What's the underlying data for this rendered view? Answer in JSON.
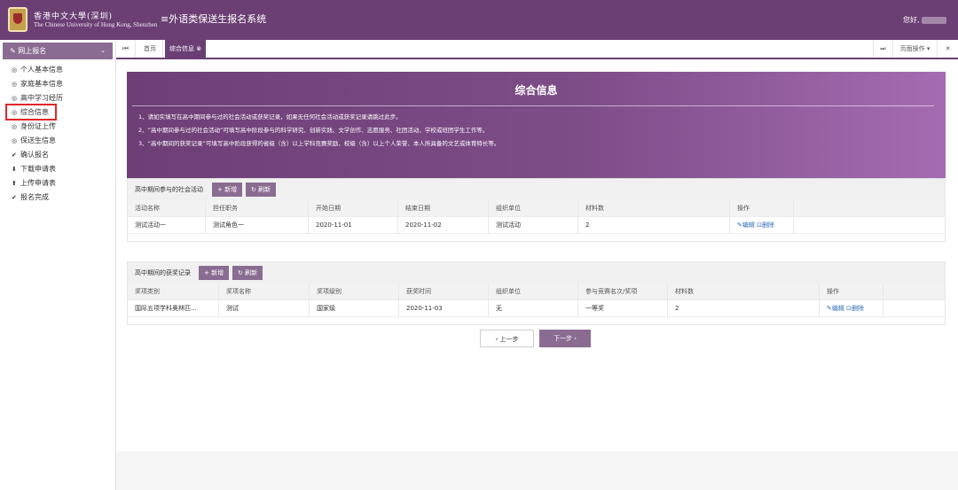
{
  "header": {
    "logo_cn": "香港中文大學(深圳)",
    "logo_en": "The Chinese University of Hong Kong, Shenzhen",
    "system_title": "≡外语类保送生报名系统",
    "greeting": "您好,"
  },
  "sidebar": {
    "section_label": "网上报名",
    "items": [
      {
        "label": "个人基本信息",
        "icon": "fingerprint-icon"
      },
      {
        "label": "家庭基本信息",
        "icon": "fingerprint-icon"
      },
      {
        "label": "高中学习经历",
        "icon": "fingerprint-icon"
      },
      {
        "label": "综合信息",
        "icon": "fingerprint-icon"
      },
      {
        "label": "身份证上传",
        "icon": "fingerprint-icon"
      },
      {
        "label": "保送生信息",
        "icon": "fingerprint-icon"
      },
      {
        "label": "确认报名",
        "icon": "check-icon"
      },
      {
        "label": "下载申请表",
        "icon": "download-icon"
      },
      {
        "label": "上传申请表",
        "icon": "upload-icon"
      },
      {
        "label": "报名完成",
        "icon": "check-icon"
      }
    ]
  },
  "tabs": {
    "home": "首页",
    "active": "综合信息",
    "page_ops": "页面操作"
  },
  "banner": {
    "title": "综合信息",
    "notes": [
      "1、请如实填写在高中期间参与过的社会活动或获奖记录，如果无任何社会活动或获奖记录请跳过此步。",
      "2、“高中期间参与过的社会活动”可填写高中阶段参与的科学研究、创新实践、文学创作、志愿服务、社团活动、学校或班团学生工作等。",
      "3、“高中期间的获奖记录”可填写高中阶段获得的省级（含）以上学科竞赛奖励、校级（含）以上个人荣誉、本人所具备的文艺或体育特长等。"
    ]
  },
  "activities": {
    "title": "高中期间参与的社会活动",
    "add_label": "+ 新增",
    "refresh_label": "刷新",
    "columns": [
      "活动名称",
      "担任职务",
      "开始日期",
      "结束日期",
      "组织单位",
      "材料数",
      "操作"
    ],
    "rows": [
      {
        "name": "测试活动一",
        "role": "测试角色一",
        "start": "2020-11-01",
        "end": "2020-11-02",
        "org": "测试活动",
        "count": "2"
      }
    ],
    "edit_label": "编辑",
    "delete_label": "删除"
  },
  "awards": {
    "title": "高中期间的获奖记录",
    "add_label": "+ 新增",
    "refresh_label": "刷新",
    "columns": [
      "奖项类别",
      "奖项名称",
      "奖项级别",
      "获奖时间",
      "组织单位",
      "参与竞赛名次/奖项",
      "材料数",
      "操作"
    ],
    "rows": [
      {
        "category": "国际五项学科奥林匹...",
        "name": "测试",
        "level": "国家级",
        "date": "2020-11-03",
        "org": "无",
        "rank": "一等奖",
        "count": "2"
      }
    ],
    "edit_label": "编辑",
    "delete_label": "删除"
  },
  "pager": {
    "prev_label": "上一步",
    "next_label": "下一步"
  },
  "colors": {
    "brand": "#6b3f74",
    "button": "#8a6c92",
    "highlight": "#e0262b"
  }
}
